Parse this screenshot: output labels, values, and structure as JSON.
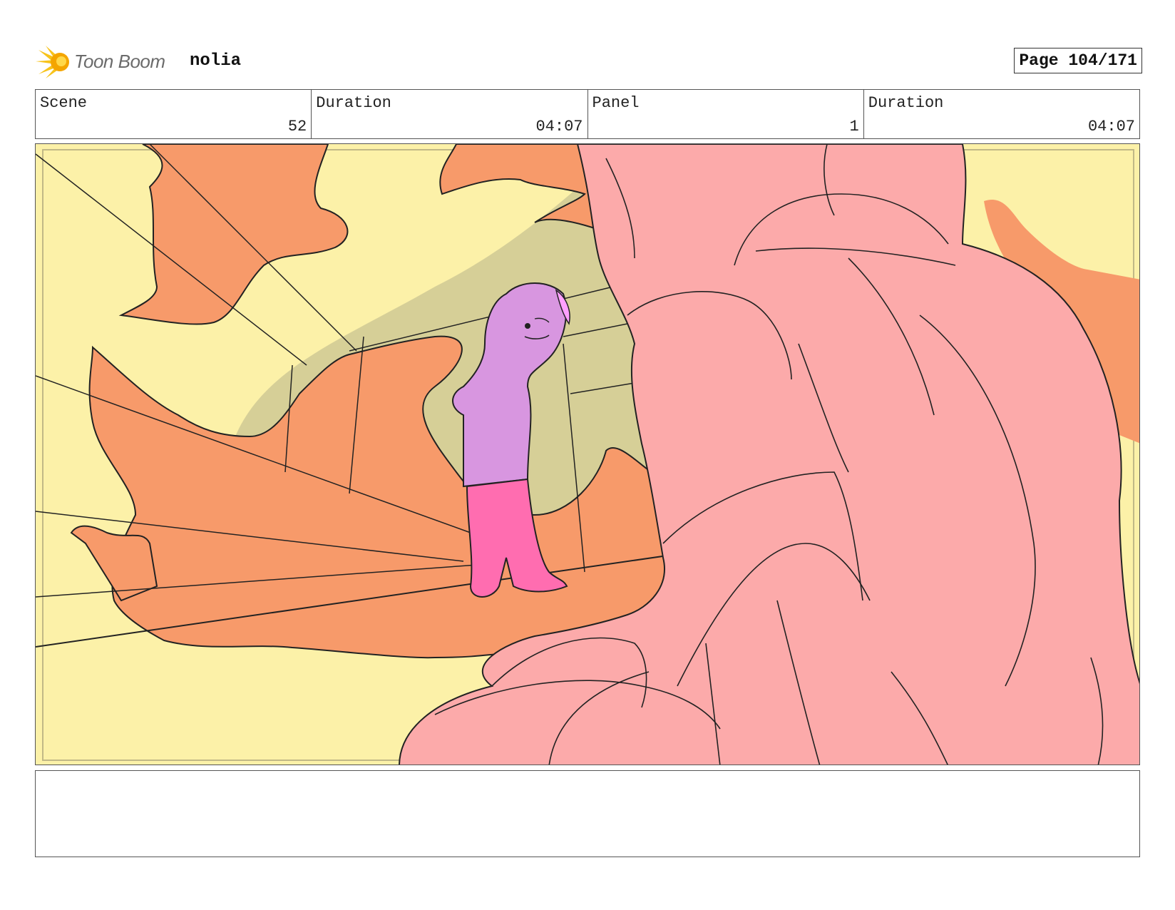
{
  "header": {
    "logo_text": "Toon Boom",
    "project_name": "nolia",
    "page_label": "Page 104/171"
  },
  "info": {
    "scene_label": "Scene",
    "scene_value": "52",
    "scene_duration_label": "Duration",
    "scene_duration_value": "04:07",
    "panel_label": "Panel",
    "panel_value": "1",
    "panel_duration_label": "Duration",
    "panel_duration_value": "04:07"
  },
  "notes": {
    "text": ""
  },
  "colors": {
    "background": "#fcf1a8",
    "rock": "#f79a6a",
    "shadow": "#d6cf97",
    "giant": "#fcaaaa",
    "girl_top": "#d896e0",
    "girl_legs": "#ff6db0"
  }
}
